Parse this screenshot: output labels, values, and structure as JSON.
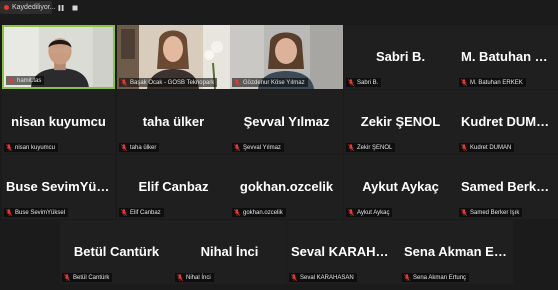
{
  "recording": {
    "label": "Kaydediliyor...",
    "pause_icon": "pause-icon",
    "stop_icon": "stop-icon"
  },
  "colors": {
    "active_border": "#8ac342",
    "tile_bg": "#1f1f1f",
    "muted_icon": "#e53935"
  },
  "participants": [
    {
      "display": "",
      "label": "hamit.tas",
      "video": true,
      "active": true
    },
    {
      "display": "",
      "label": "Başak Ocak - GOSB Teknopark",
      "video": true
    },
    {
      "display": "",
      "label": "Gözdenur Köse Yılmaz",
      "video": true
    },
    {
      "display": "Sabri B.",
      "label": "Sabri B."
    },
    {
      "display": "M. Batuhan  ER...",
      "label": "M. Batuhan ERKEK"
    },
    {
      "display": "nisan kuyumcu",
      "label": "nisan kuyumcu"
    },
    {
      "display": "taha ülker",
      "label": "taha ülker"
    },
    {
      "display": "Şevval Yılmaz",
      "label": "Şevval Yılmaz"
    },
    {
      "display": "Zekir ŞENOL",
      "label": "Zekir ŞENOL"
    },
    {
      "display": "Kudret DUMAN",
      "label": "Kudret DUMAN"
    },
    {
      "display": "Buse SevimYüksel",
      "label": "Buse SevimYüksel"
    },
    {
      "display": "Elif Canbaz",
      "label": "Elif Canbaz"
    },
    {
      "display": "gokhan.ozcelik",
      "label": "gokhan.ozcelik"
    },
    {
      "display": "Aykut Aykaç",
      "label": "Aykut Aykaç"
    },
    {
      "display": "Samed Berker Işık",
      "label": "Samed Berker Işık"
    },
    {
      "display": "Betül Cantürk",
      "label": "Betül Cantürk"
    },
    {
      "display": "Nihal İnci",
      "label": "Nihal İnci"
    },
    {
      "display": "Seval  KARAHAS...",
      "label": "Seval KARAHASAN"
    },
    {
      "display": "Sena  Akman  Ert...",
      "label": "Sena Akman Ertunç"
    }
  ]
}
